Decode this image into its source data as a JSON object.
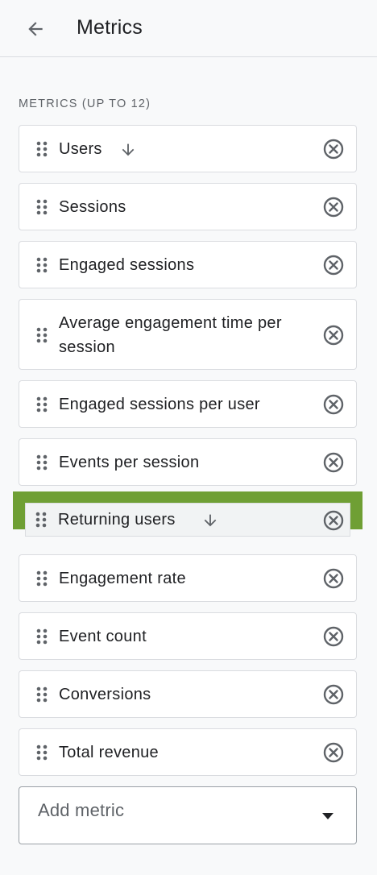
{
  "header": {
    "title": "Metrics",
    "back_icon": "arrow-back-icon"
  },
  "section": {
    "label": "METRICS (UP TO 12)"
  },
  "metrics": [
    {
      "label": "Users",
      "sorted": true
    },
    {
      "label": "Sessions",
      "sorted": false
    },
    {
      "label": "Engaged sessions",
      "sorted": false
    },
    {
      "label": "Average engagement time per session",
      "sorted": false
    },
    {
      "label": "Engaged sessions per user",
      "sorted": false
    },
    {
      "label": "Events per session",
      "sorted": false
    },
    {
      "label": "Returning users",
      "sorted": true,
      "highlighted": true
    },
    {
      "label": "Engagement rate",
      "sorted": false
    },
    {
      "label": "Event count",
      "sorted": false
    },
    {
      "label": "Conversions",
      "sorted": false
    },
    {
      "label": "Total revenue",
      "sorted": false
    }
  ],
  "add_metric": {
    "placeholder": "Add metric"
  },
  "colors": {
    "highlight": "#6f9f34",
    "icon": "#5f6368",
    "border": "#dadce0"
  }
}
